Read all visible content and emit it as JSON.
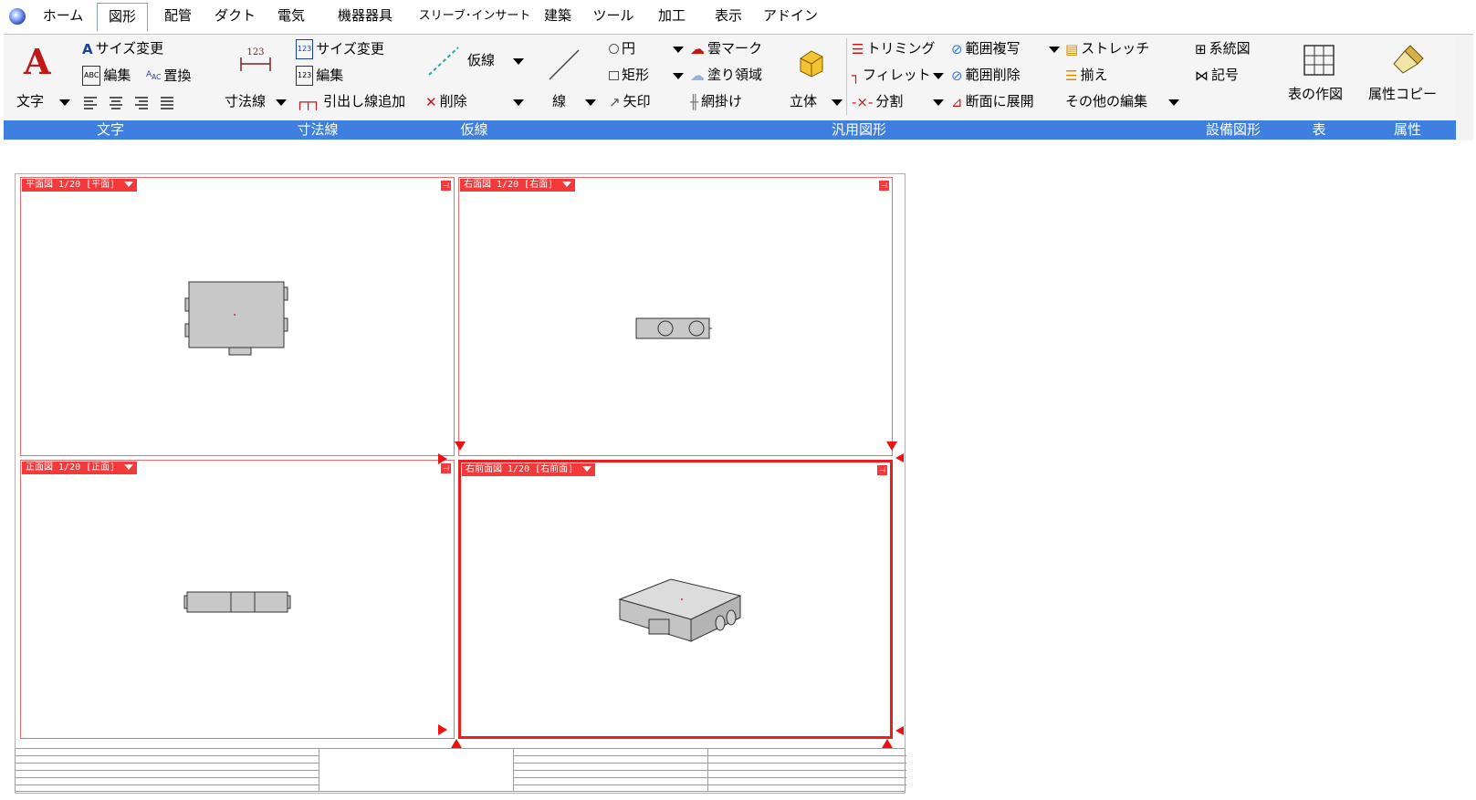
{
  "menu": {
    "items": [
      "ホーム",
      "図形",
      "配管",
      "ダクト",
      "電気",
      "機器器具",
      "スリーブ･インサート",
      "建築",
      "ツール",
      "加工",
      "表示",
      "アドイン"
    ],
    "active": "図形"
  },
  "ribbon": {
    "moji": {
      "group_label": "文字",
      "main_label": "文字",
      "size_change": "サイズ変更",
      "edit": "編集",
      "replace": "置換"
    },
    "sunpo": {
      "group_label": "寸法線",
      "main_label": "寸法線",
      "icon_text": "123",
      "size_change": "サイズ変更",
      "edit": "編集",
      "leader_add": "引出し線追加"
    },
    "karisen": {
      "group_label": "仮線",
      "main_label": "仮線",
      "delete": "削除"
    },
    "hanyou": {
      "group_label": "汎用図形",
      "line": "線",
      "circle": "円",
      "rect": "矩形",
      "arrow": "矢印",
      "cloud": "雲マーク",
      "fill": "塗り領域",
      "hatch": "網掛け",
      "solid": "立体",
      "trim": "トリミング",
      "fillet": "フィレット",
      "split": "分割",
      "range_copy": "範囲複写",
      "range_delete": "範囲削除",
      "section": "断面に展開",
      "stretch": "ストレッチ",
      "align": "揃え",
      "other_edit": "その他の編集"
    },
    "setsubi": {
      "group_label": "設備図形",
      "system": "系統図",
      "symbol": "記号"
    },
    "table": {
      "group_label": "表",
      "create": "表の作図"
    },
    "attr": {
      "group_label": "属性",
      "copy": "属性コピー"
    }
  },
  "viewports": {
    "top_left": {
      "label": "平面図 1/20 [平面]"
    },
    "top_right": {
      "label": "右面図 1/20 [右面]"
    },
    "bottom_left": {
      "label": "正面図 1/20 [正面]"
    },
    "bottom_right": {
      "label": "右前面図 1/20 [右前面]",
      "selected": true
    }
  },
  "colors": {
    "group_label_bg": "#3f7fe0",
    "viewport_red": "#ee1c1c",
    "equipment_fill": "#c8c8c8"
  }
}
